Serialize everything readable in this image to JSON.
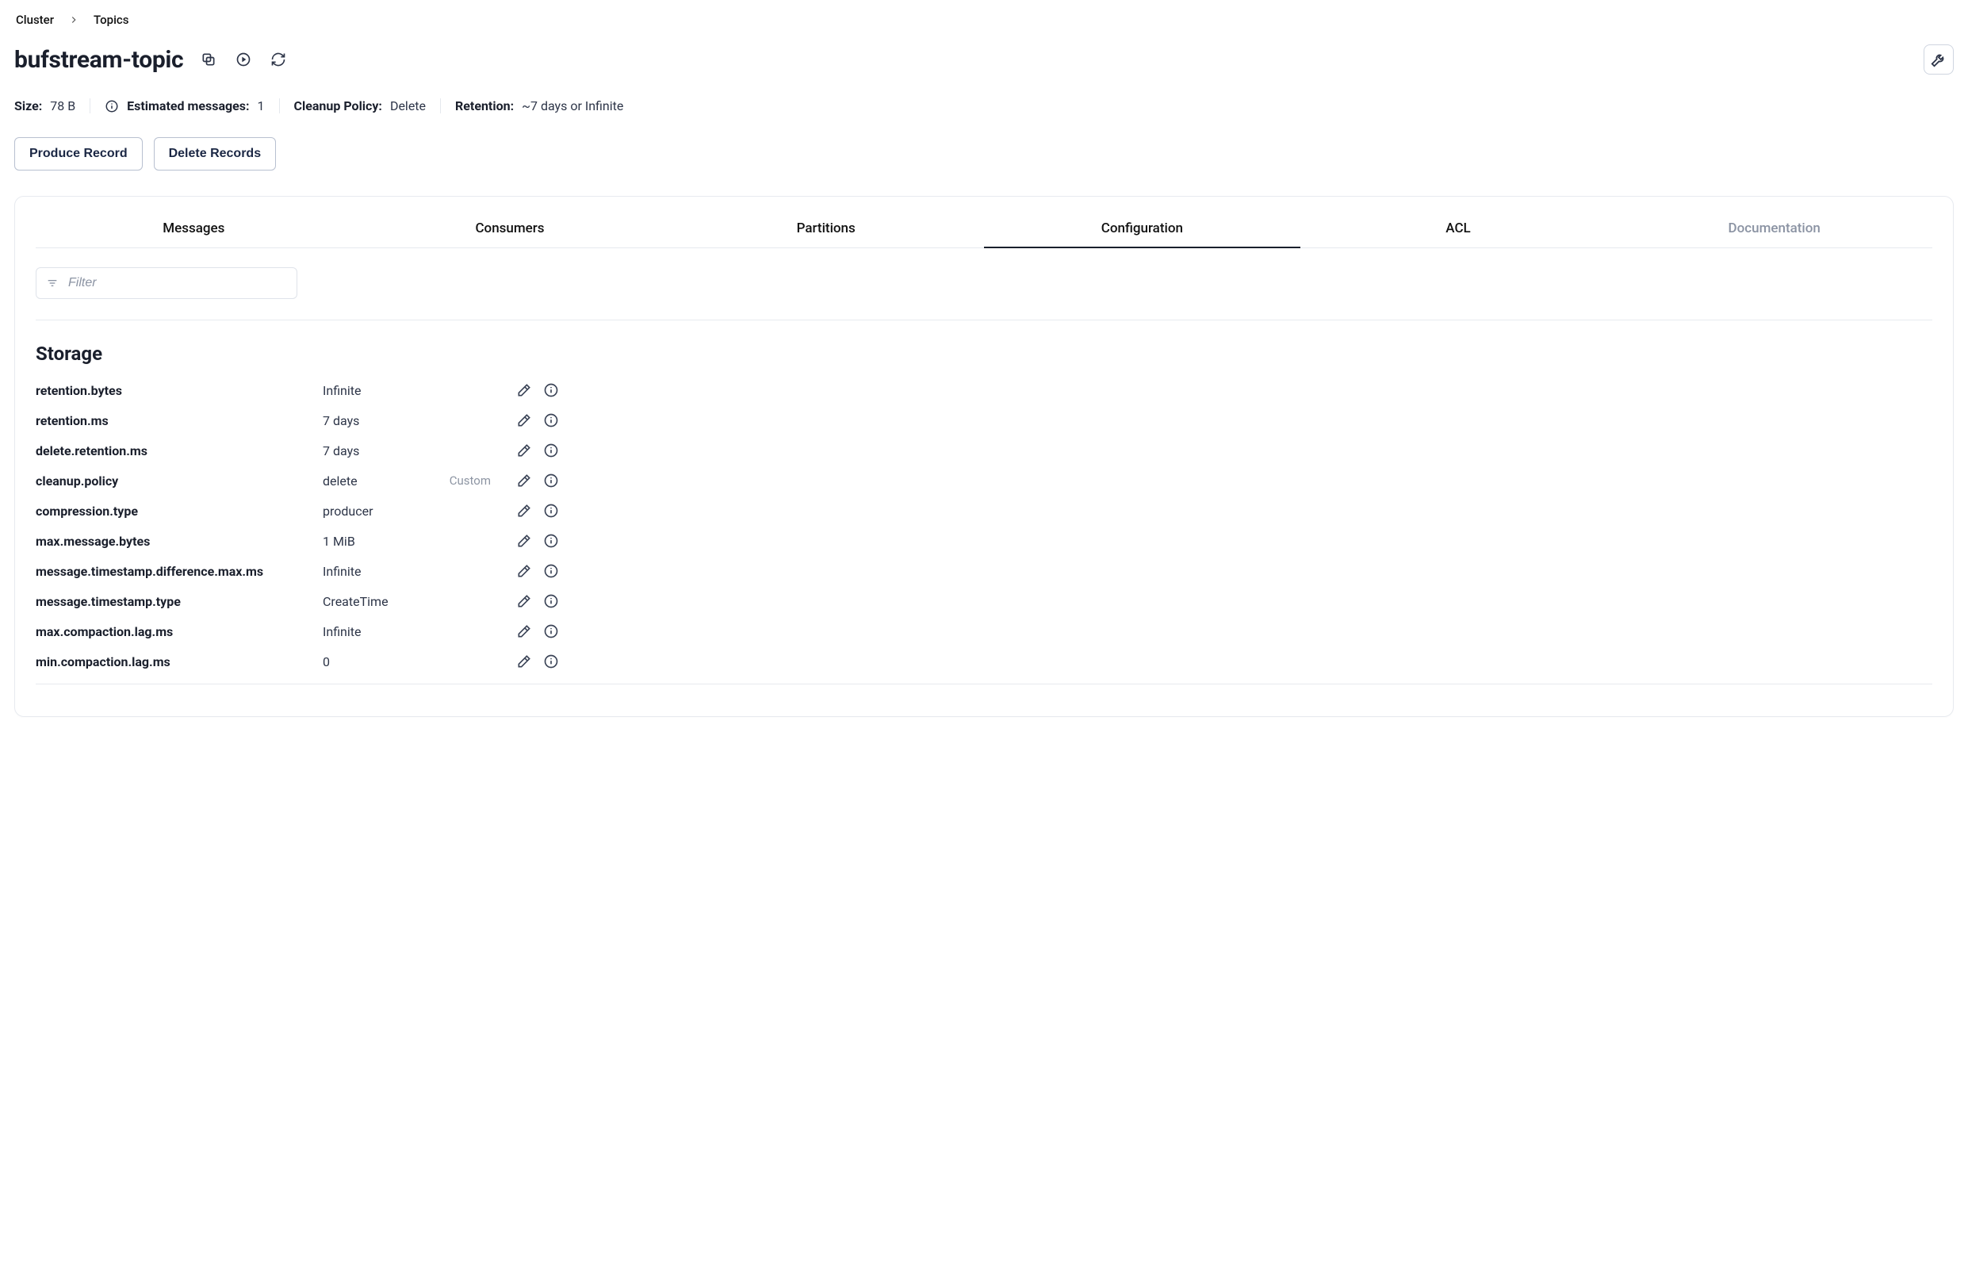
{
  "breadcrumbs": {
    "cluster": "Cluster",
    "topics": "Topics"
  },
  "title": "bufstream-topic",
  "stats": {
    "size_label": "Size:",
    "size_value": "78 B",
    "est_label": "Estimated messages:",
    "est_value": "1",
    "cleanup_label": "Cleanup Policy:",
    "cleanup_value": "Delete",
    "retention_label": "Retention:",
    "retention_value": "~7 days or Infinite"
  },
  "buttons": {
    "produce": "Produce Record",
    "delete": "Delete Records"
  },
  "tabs": {
    "messages": "Messages",
    "consumers": "Consumers",
    "partitions": "Partitions",
    "configuration": "Configuration",
    "acl": "ACL",
    "documentation": "Documentation"
  },
  "filter_placeholder": "Filter",
  "section_title": "Storage",
  "config": [
    {
      "key": "retention.bytes",
      "value": "Infinite",
      "badge": ""
    },
    {
      "key": "retention.ms",
      "value": "7 days",
      "badge": ""
    },
    {
      "key": "delete.retention.ms",
      "value": "7 days",
      "badge": ""
    },
    {
      "key": "cleanup.policy",
      "value": "delete",
      "badge": "Custom"
    },
    {
      "key": "compression.type",
      "value": "producer",
      "badge": ""
    },
    {
      "key": "max.message.bytes",
      "value": "1 MiB",
      "badge": ""
    },
    {
      "key": "message.timestamp.difference.max.ms",
      "value": "Infinite",
      "badge": ""
    },
    {
      "key": "message.timestamp.type",
      "value": "CreateTime",
      "badge": ""
    },
    {
      "key": "max.compaction.lag.ms",
      "value": "Infinite",
      "badge": ""
    },
    {
      "key": "min.compaction.lag.ms",
      "value": "0",
      "badge": ""
    }
  ]
}
